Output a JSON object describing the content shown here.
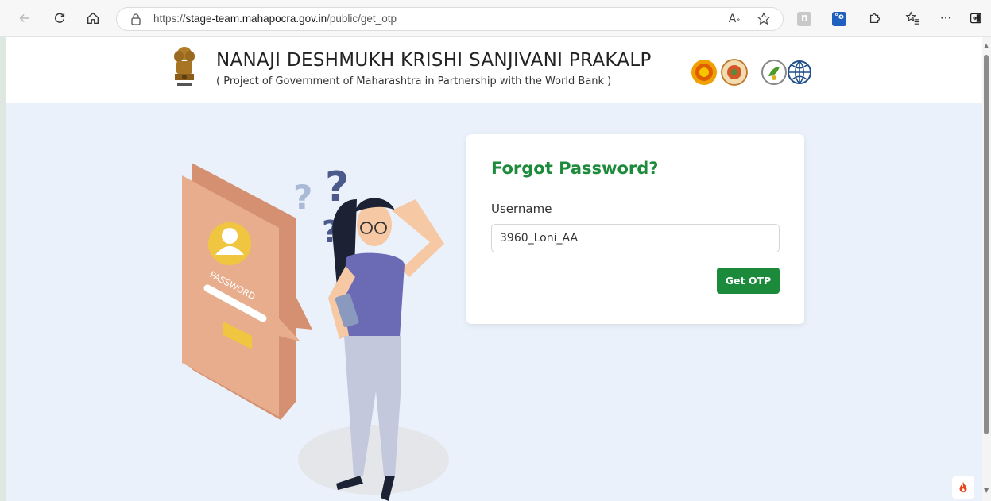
{
  "browser": {
    "url_scheme": "https://",
    "url_host": "stage-team.mahapocra.gov.in",
    "url_path": "/public/get_otp",
    "read_aloud_label": "A",
    "more_label": "···"
  },
  "header": {
    "title": "NANAJI DESHMUKH KRISHI SANJIVANI PRAKALP",
    "subtitle": "( Project of Government of Maharashtra in Partnership with the World Bank )"
  },
  "form": {
    "title": "Forgot Password?",
    "username_label": "Username",
    "username_value": "3960_Loni_AA",
    "submit_label": "Get OTP"
  },
  "illustration": {
    "password_label": "PASSWORD"
  },
  "colors": {
    "accent": "#1b8a3a",
    "title_green": "#1e8a3c",
    "page_bg": "#eaf1fb"
  }
}
